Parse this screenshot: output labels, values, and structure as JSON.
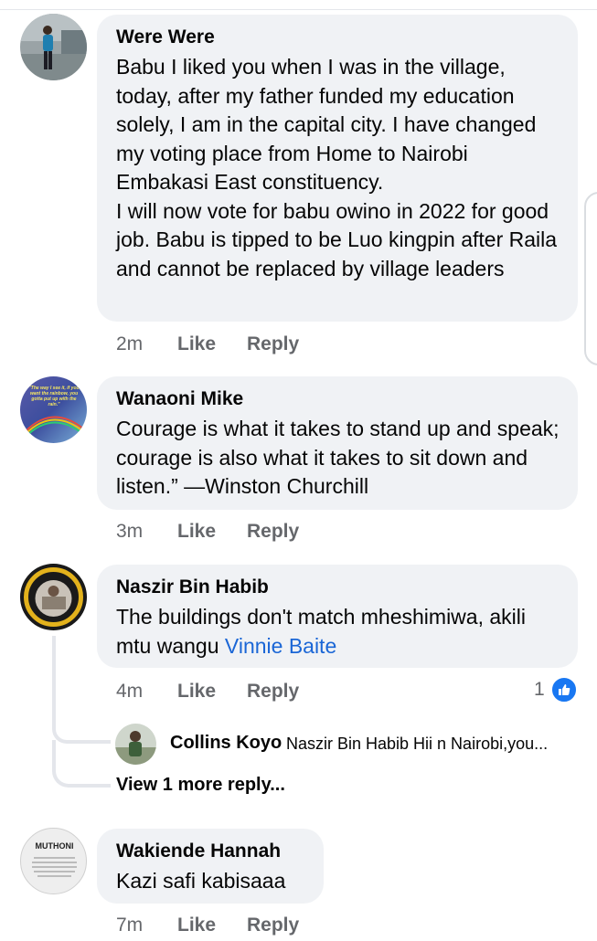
{
  "comments": [
    {
      "author": "Were Were",
      "text": "Babu I liked you when I was in the village, today, after my father funded my education solely, I am in the capital city. I have changed  my voting place from Home to Nairobi Embakasi East constituency.\nI will now vote for babu owino in 2022 for good job. Babu is tipped to be Luo kingpin after Raila and cannot be replaced by village leaders",
      "time": "2m",
      "like_label": "Like",
      "reply_label": "Reply"
    },
    {
      "author": "Wanaoni Mike",
      "text": "Courage is what it takes to stand up and speak; courage is also what it takes to sit down and listen.” —Winston Churchill",
      "avatar_text": "\"The way I see it, if you want the rainbow, you gotta put up with the rain.\"",
      "time": "3m",
      "like_label": "Like",
      "reply_label": "Reply"
    },
    {
      "author": "Naszir Bin Habib",
      "text": "The buildings don't match mheshimiwa, akili mtu wangu ",
      "mention": "Vinnie Baite",
      "time": "4m",
      "like_label": "Like",
      "reply_label": "Reply",
      "reaction_count": "1",
      "reaction_icon": "thumbs-up-icon",
      "reply": {
        "author": "Collins Koyo",
        "snippet": "Naszir Bin Habib Hii n Nairobi,you..."
      },
      "view_more": "View 1 more reply..."
    },
    {
      "author": "Wakiende Hannah",
      "text": "Kazi safi kabisaaa",
      "avatar_text": "MUTHONI",
      "time": "7m",
      "like_label": "Like",
      "reply_label": "Reply"
    }
  ],
  "colors": {
    "bubble": "#f0f2f5",
    "meta": "#65676b",
    "mention": "#1a66d6",
    "like_blue": "#1877f2"
  }
}
